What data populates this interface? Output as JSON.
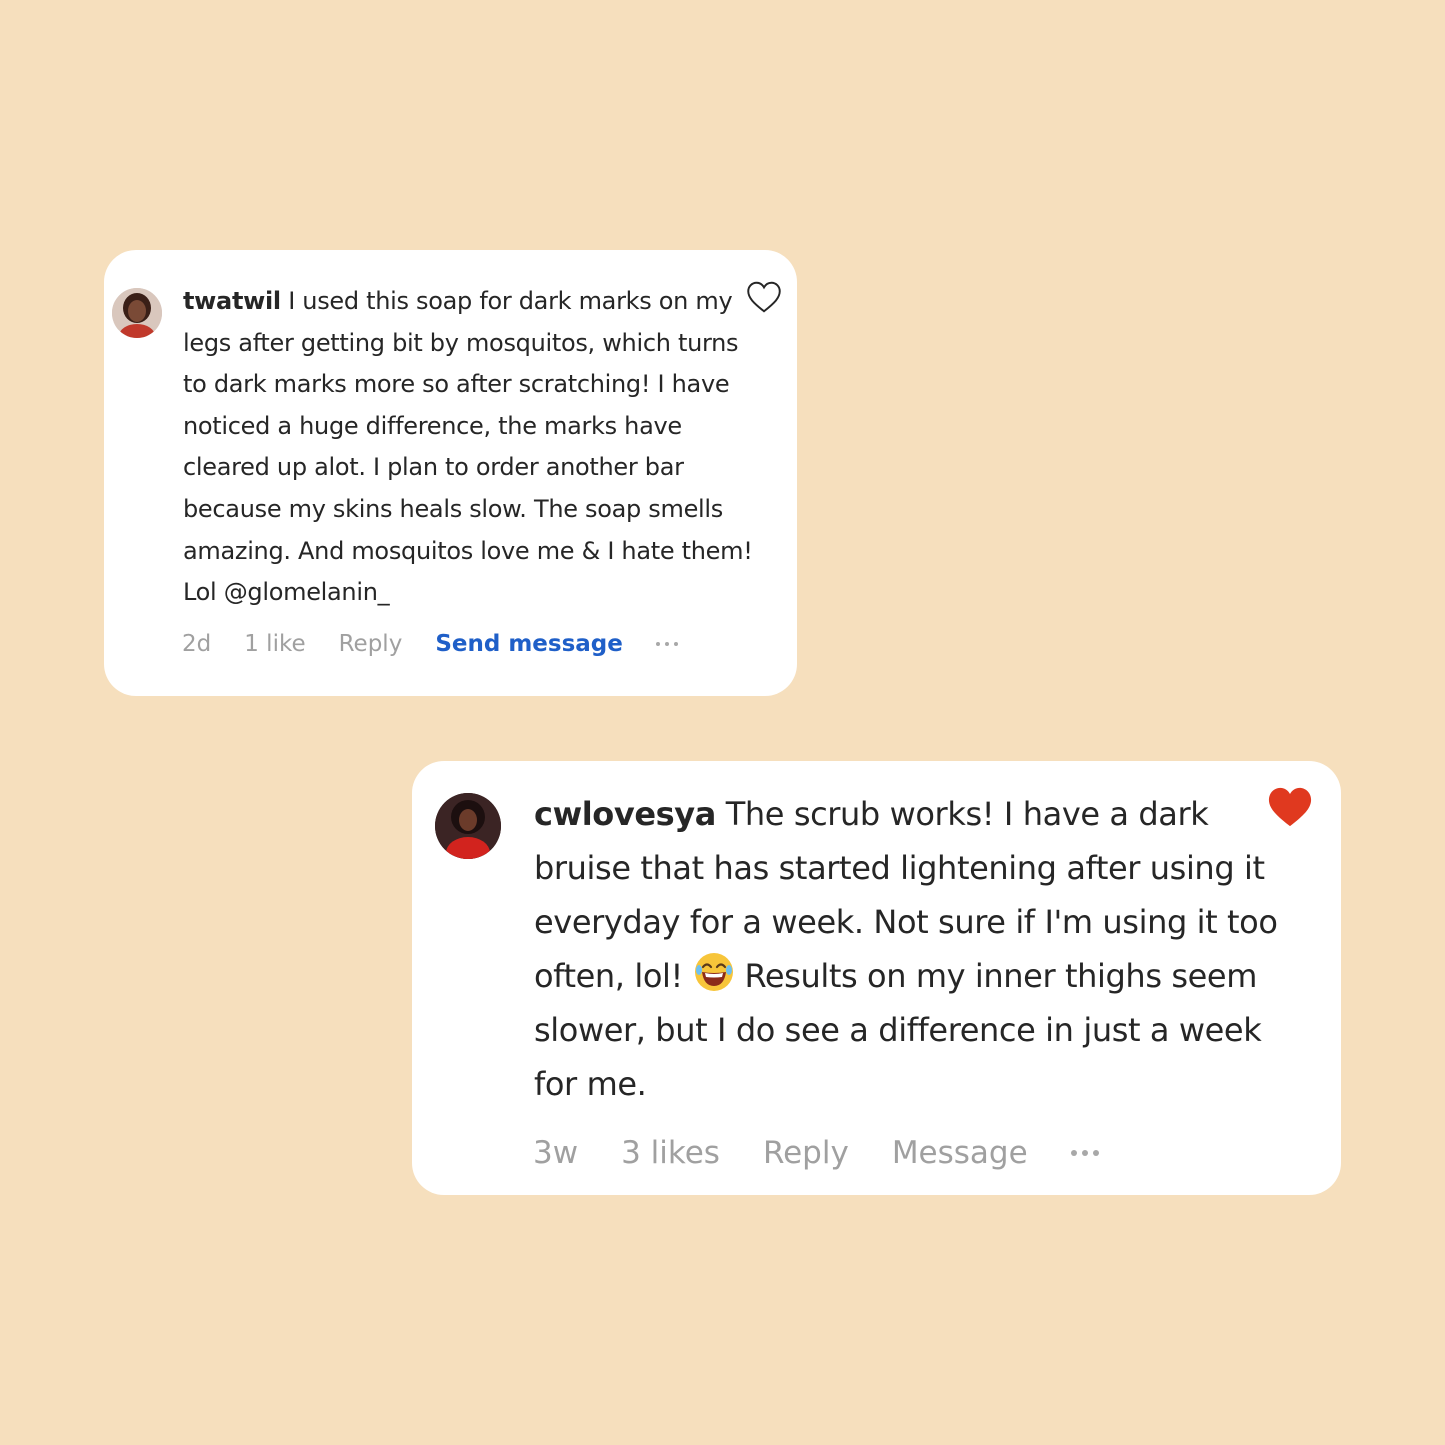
{
  "comments": [
    {
      "username": "twatwil",
      "text": "I used this soap for dark marks on my legs after getting bit by mosquitos, which turns to dark marks more so after scratching! I have noticed a huge difference, the marks have cleared up alot. I plan to order another bar because my skins heals slow. The soap smells amazing. And mosquitos love me & I hate them! Lol @glomelanin_",
      "time": "2d",
      "likes": "1 like",
      "reply_label": "Reply",
      "message_label": "Send message",
      "liked": false,
      "avatar_icon": "user-avatar"
    },
    {
      "username": "cwlovesya",
      "text_before_emoji": "The scrub works! I have a dark bruise that has started lightening after using it everyday for a week. Not sure if I'm using it too often, lol!",
      "emoji": "face-with-tears-of-joy",
      "text_after_emoji": "Results on my inner thighs seem slower, but I do see a difference in just a week for me.",
      "time": "3w",
      "likes": "3 likes",
      "reply_label": "Reply",
      "message_label": "Message",
      "liked": true,
      "avatar_icon": "user-avatar"
    }
  ],
  "colors": {
    "background": "#f6dfbd",
    "card": "#ffffff",
    "text": "#262626",
    "meta": "#a0a0a0",
    "link": "#1f5fc8",
    "heart_filled": "#e0391f",
    "heart_outline": "#262626"
  },
  "icons": {
    "like_outline": "heart-outline-icon",
    "like_filled": "heart-filled-icon",
    "more": "more-options-icon"
  }
}
